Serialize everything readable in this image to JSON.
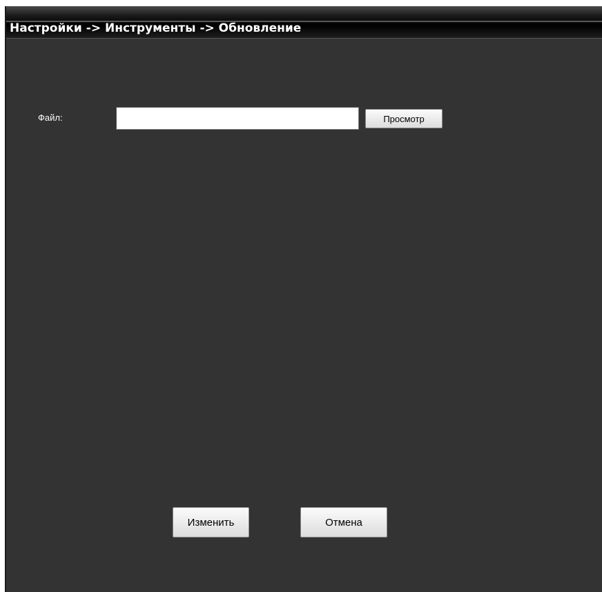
{
  "header": {
    "breadcrumb": "Настройки -> Инструменты -> Обновление"
  },
  "form": {
    "file_label": "Файл:",
    "file_value": "",
    "browse_label": "Просмотр"
  },
  "actions": {
    "apply_label": "Изменить",
    "cancel_label": "Отмена"
  },
  "colors": {
    "panel_background": "#333333",
    "header_background": "#000000",
    "text": "#ffffff"
  }
}
